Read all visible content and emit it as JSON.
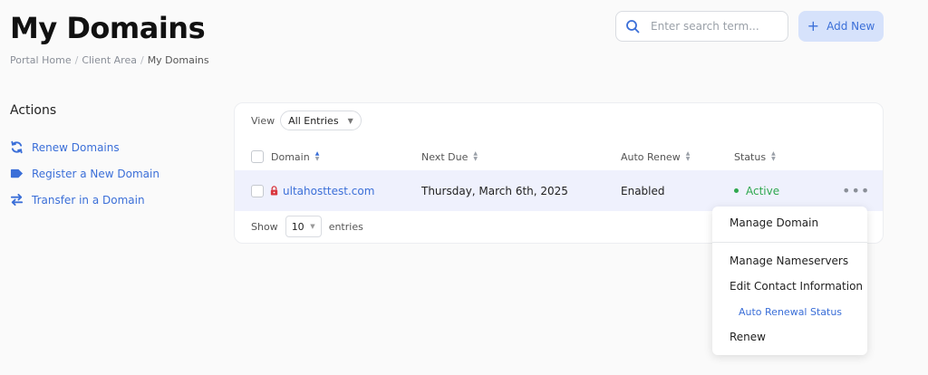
{
  "page": {
    "title": "My Domains"
  },
  "breadcrumb": {
    "items": [
      "Portal Home",
      "Client Area",
      "My Domains"
    ]
  },
  "search": {
    "placeholder": "Enter search term..."
  },
  "toolbar": {
    "add_new_label": "Add New",
    "accent_color": "#3b6fd8"
  },
  "sidebar": {
    "title": "Actions",
    "items": [
      {
        "label": "Renew Domains",
        "icon": "sync-icon"
      },
      {
        "label": "Register a New Domain",
        "icon": "tag-icon"
      },
      {
        "label": "Transfer in a Domain",
        "icon": "transfer-arrows-icon"
      }
    ]
  },
  "table": {
    "view_label": "View",
    "view_selected": "All Entries",
    "columns": [
      "Domain",
      "Next Due",
      "Auto Renew",
      "Status"
    ],
    "rows": [
      {
        "domain": "ultahosttest.com",
        "next_due": "Thursday, March 6th, 2025",
        "auto_renew": "Enabled",
        "status": "Active"
      }
    ],
    "show_label": "Show",
    "page_size": "10",
    "entries_label": "entries"
  },
  "dropdown": {
    "items": [
      "Manage Domain",
      "Manage Nameservers",
      "Edit Contact Information",
      "Auto Renewal Status",
      "Renew"
    ]
  }
}
